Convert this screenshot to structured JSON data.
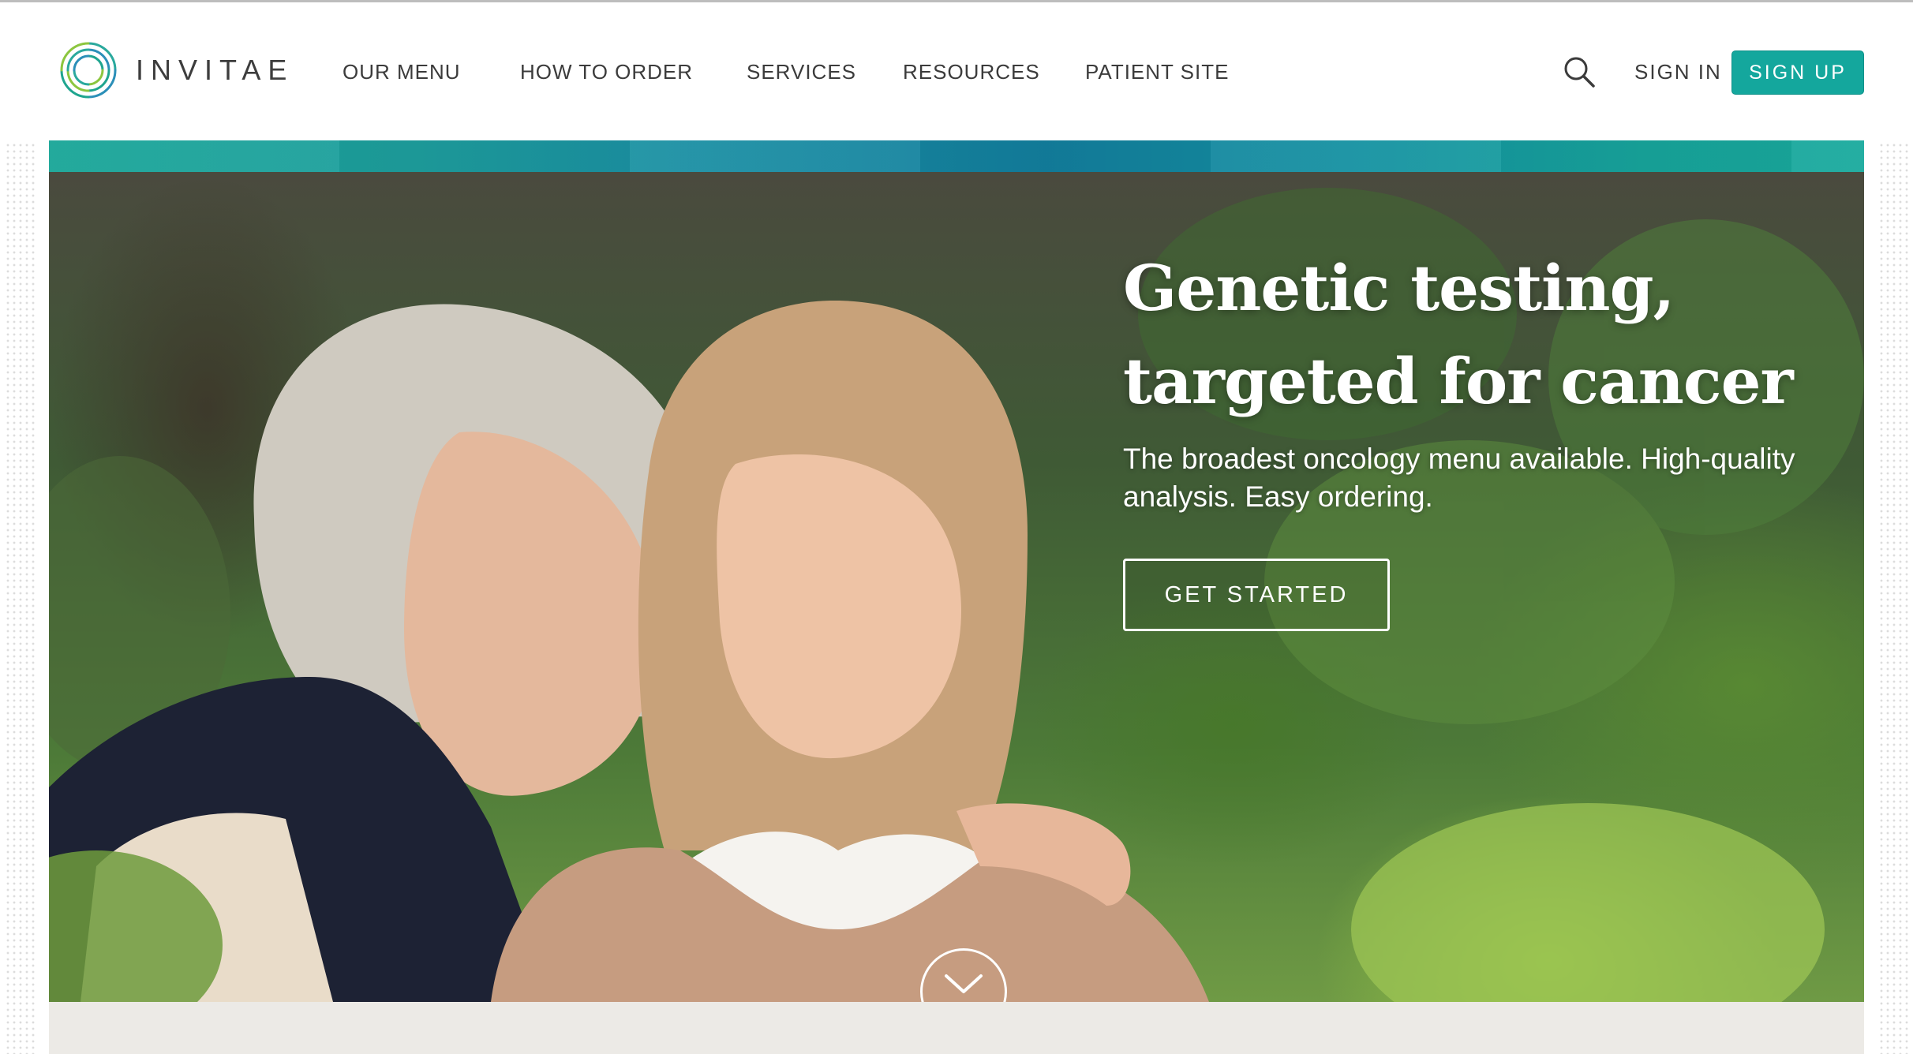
{
  "brand": {
    "name": "INVITAE"
  },
  "nav": {
    "items": [
      {
        "label": "OUR MENU"
      },
      {
        "label": "HOW TO ORDER"
      },
      {
        "label": "SERVICES"
      },
      {
        "label": "RESOURCES"
      },
      {
        "label": "PATIENT SITE"
      }
    ],
    "search_icon": "search-icon",
    "signin_label": "SIGN IN",
    "signup_label": "SIGN UP"
  },
  "hero": {
    "headline_line1": "Genetic testing,",
    "headline_line2": "targeted for cancer",
    "subhead": "The broadest oncology menu available. High-quality analysis. Easy ordering.",
    "cta_label": "GET STARTED",
    "scroll_icon": "chevron-down-icon"
  },
  "colors": {
    "accent": "#14a79d",
    "banner": "#1a8fa3",
    "text": "#3b3b3b"
  }
}
